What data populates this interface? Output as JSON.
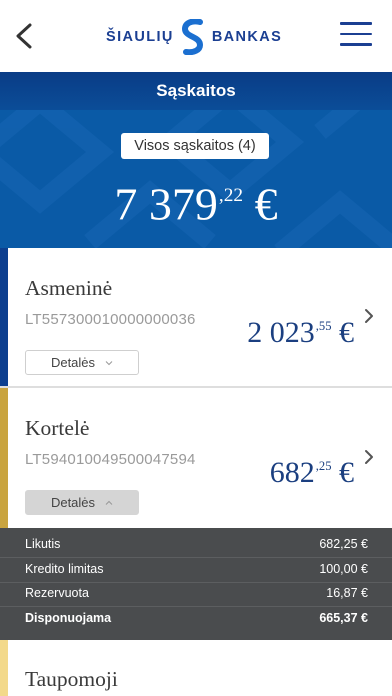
{
  "header": {
    "brand_left": "ŠIAULIŲ",
    "brand_right": "BANKAS",
    "title": "Sąskaitos"
  },
  "summary": {
    "all_accounts_label": "Visos sąskaitos (4)",
    "total_integer": "7 379",
    "total_decimal": ",22",
    "currency": "€"
  },
  "accounts": [
    {
      "name": "Asmeninė",
      "iban": "LT557300010000000036",
      "amount_integer": "2 023",
      "amount_decimal": ",55",
      "currency": "€",
      "details_label": "Detalės",
      "stripe_color": "#0d3f8f"
    },
    {
      "name": "Kortelė",
      "iban": "LT594010049500047594",
      "amount_integer": "682",
      "amount_decimal": ",25",
      "currency": "€",
      "details_label": "Detalės",
      "stripe_color": "#c9a43f",
      "details": [
        {
          "label": "Likutis",
          "value": "682,25 €"
        },
        {
          "label": "Kredito limitas",
          "value": "100,00 €"
        },
        {
          "label": "Rezervuota",
          "value": "16,87 €"
        },
        {
          "label": "Disponuojama",
          "value": "665,37 €"
        }
      ]
    },
    {
      "name": "Taupomoji",
      "stripe_color": "#f3d98a"
    }
  ],
  "colors": {
    "brand_blue": "#1b3f92",
    "hero_blue": "#0a5aa6",
    "amount_blue": "#1b3f80",
    "panel_bg": "#4a4c4e"
  },
  "icons": {
    "back": "chevron-left-icon",
    "menu": "hamburger-menu-icon",
    "logo": "bank-logo-icon",
    "row_arrow": "chevron-right-icon"
  }
}
